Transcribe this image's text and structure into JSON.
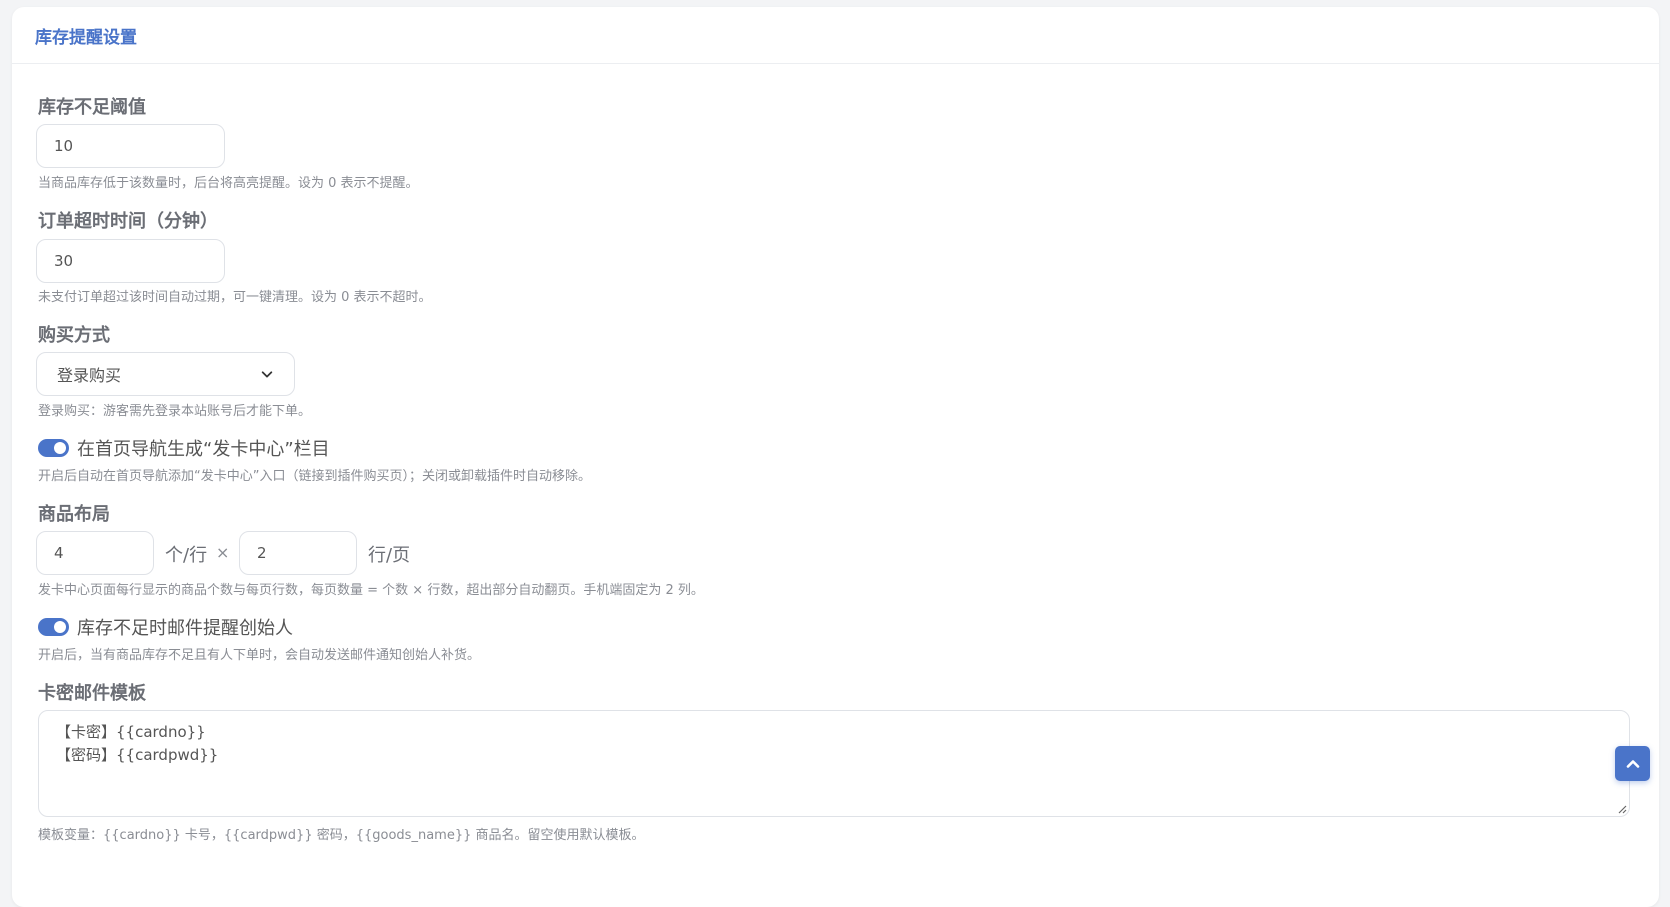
{
  "header": {
    "title": "库存提醒设置"
  },
  "stock_threshold": {
    "label": "库存不足阈值",
    "value": "10",
    "help": "当商品库存低于该数量时，后台将高亮提醒。设为 0 表示不提醒。"
  },
  "order_timeout": {
    "label": "订单超时时间（分钟）",
    "value": "30",
    "help": "未支付订单超过该时间自动过期，可一键清理。设为 0 表示不超时。"
  },
  "purchase_mode": {
    "label": "购买方式",
    "selected": "登录购买",
    "help": "登录购买：游客需先登录本站账号后才能下单。"
  },
  "nav_toggle": {
    "enabled": true,
    "label": "在首页导航生成“发卡中心”栏目",
    "help": "开启后自动在首页导航添加“发卡中心”入口（链接到插件购买页）；关闭或卸载插件时自动移除。"
  },
  "layout": {
    "label": "商品布局",
    "per_row": "4",
    "per_row_unit": "个/行",
    "times": "×",
    "rows": "2",
    "rows_unit": "行/页",
    "help": "发卡中心页面每行显示的商品个数与每页行数，每页数量 = 个数 × 行数，超出部分自动翻页。手机端固定为 2 列。"
  },
  "mail_toggle": {
    "enabled": true,
    "label": "库存不足时邮件提醒创始人",
    "help": "开启后，当有商品库存不足且有人下单时，会自动发送邮件通知创始人补货。"
  },
  "mail_template": {
    "label": "卡密邮件模板",
    "lines": [
      "【卡密】{{cardno}}",
      "【密码】{{cardpwd}}"
    ],
    "help": "模板变量：{{cardno}} 卡号，{{cardpwd}} 密码，{{goods_name}} 商品名。留空使用默认模板。"
  },
  "colors": {
    "accent": "#4a74c9",
    "border": "#dfe2e7"
  },
  "icons": {
    "select": "chevron-down-icon",
    "back_to_top": "chevron-up-icon"
  }
}
